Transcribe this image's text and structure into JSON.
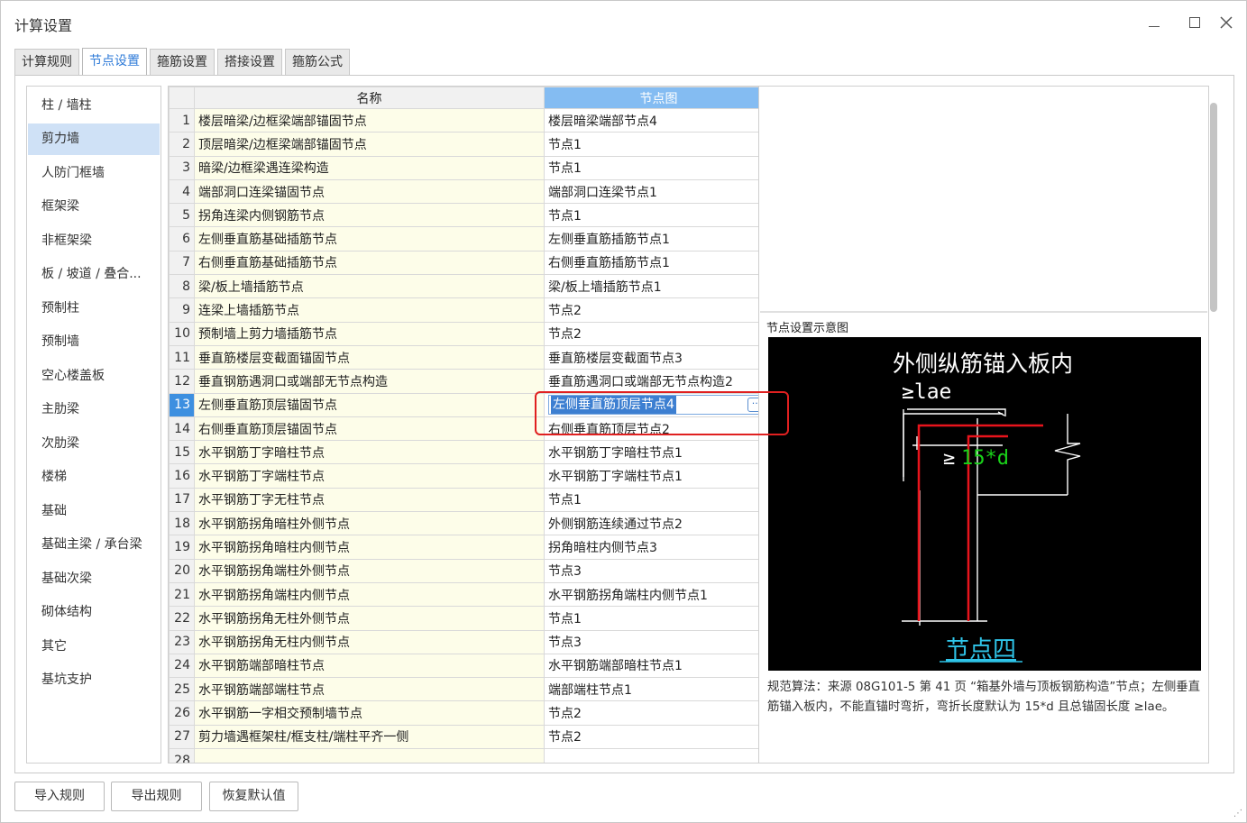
{
  "window": {
    "title": "计算设置"
  },
  "tabs": [
    "计算规则",
    "节点设置",
    "箍筋设置",
    "搭接设置",
    "箍筋公式"
  ],
  "sidebar": {
    "items": [
      "柱 / 墙柱",
      "剪力墙",
      "人防门框墙",
      "框架梁",
      "非框架梁",
      "板 / 坡道 / 叠合...",
      "预制柱",
      "预制墙",
      "空心楼盖板",
      "主肋梁",
      "次肋梁",
      "楼梯",
      "基础",
      "基础主梁 / 承台梁",
      "基础次梁",
      "砌体结构",
      "其它",
      "基坑支护"
    ]
  },
  "grid": {
    "headers": {
      "name": "名称",
      "node": "节点图"
    },
    "rows": [
      {
        "no": "1",
        "name": "楼层暗梁/边框梁端部锚固节点",
        "node": "楼层暗梁端部节点4"
      },
      {
        "no": "2",
        "name": "顶层暗梁/边框梁端部锚固节点",
        "node": "节点1"
      },
      {
        "no": "3",
        "name": "暗梁/边框梁遇连梁构造",
        "node": "节点1"
      },
      {
        "no": "4",
        "name": "端部洞口连梁锚固节点",
        "node": "端部洞口连梁节点1"
      },
      {
        "no": "5",
        "name": "拐角连梁内侧钢筋节点",
        "node": "节点1"
      },
      {
        "no": "6",
        "name": "左侧垂直筋基础插筋节点",
        "node": "左侧垂直筋插筋节点1"
      },
      {
        "no": "7",
        "name": "右侧垂直筋基础插筋节点",
        "node": "右侧垂直筋插筋节点1"
      },
      {
        "no": "8",
        "name": "梁/板上墙插筋节点",
        "node": "梁/板上墙插筋节点1"
      },
      {
        "no": "9",
        "name": "连梁上墙插筋节点",
        "node": "节点2"
      },
      {
        "no": "10",
        "name": "预制墙上剪力墙插筋节点",
        "node": "节点2"
      },
      {
        "no": "11",
        "name": "垂直筋楼层变截面锚固节点",
        "node": "垂直筋楼层变截面节点3"
      },
      {
        "no": "12",
        "name": "垂直钢筋遇洞口或端部无节点构造",
        "node": "垂直筋遇洞口或端部无节点构造2"
      },
      {
        "no": "13",
        "name": "左侧垂直筋顶层锚固节点",
        "node": "左侧垂直筋顶层节点4"
      },
      {
        "no": "14",
        "name": "右侧垂直筋顶层锚固节点",
        "node": "右侧垂直筋顶层节点2"
      },
      {
        "no": "15",
        "name": "水平钢筋丁字暗柱节点",
        "node": "水平钢筋丁字暗柱节点1"
      },
      {
        "no": "16",
        "name": "水平钢筋丁字端柱节点",
        "node": "水平钢筋丁字端柱节点1"
      },
      {
        "no": "17",
        "name": "水平钢筋丁字无柱节点",
        "node": "节点1"
      },
      {
        "no": "18",
        "name": "水平钢筋拐角暗柱外侧节点",
        "node": "外侧钢筋连续通过节点2"
      },
      {
        "no": "19",
        "name": "水平钢筋拐角暗柱内侧节点",
        "node": "拐角暗柱内侧节点3"
      },
      {
        "no": "20",
        "name": "水平钢筋拐角端柱外侧节点",
        "node": "节点3"
      },
      {
        "no": "21",
        "name": "水平钢筋拐角端柱内侧节点",
        "node": "水平钢筋拐角端柱内侧节点1"
      },
      {
        "no": "22",
        "name": "水平钢筋拐角无柱外侧节点",
        "node": "节点1"
      },
      {
        "no": "23",
        "name": "水平钢筋拐角无柱内侧节点",
        "node": "节点3"
      },
      {
        "no": "24",
        "name": "水平钢筋端部暗柱节点",
        "node": "水平钢筋端部暗柱节点1"
      },
      {
        "no": "25",
        "name": "水平钢筋端部端柱节点",
        "node": "端部端柱节点1"
      },
      {
        "no": "26",
        "name": "水平钢筋一字相交预制墙节点",
        "node": "节点2"
      },
      {
        "no": "27",
        "name": "剪力墙遇框架柱/框支柱/端柱平齐一侧",
        "node": "节点2"
      },
      {
        "no": "28",
        "name": "",
        "node": ""
      }
    ]
  },
  "diagram": {
    "label": "节点设置示意图",
    "heading": "外侧纵筋锚入板内",
    "lae_label": "≥lae",
    "d_label_prefix": "≥",
    "d_label": "15*d",
    "node_name": "节点四",
    "colors": {
      "background": "#000000",
      "rebar": "#e8141c",
      "outline": "#ffffff",
      "dim_text": "#19d219",
      "node_text": "#2fc4e8"
    }
  },
  "description": "规范算法：来源 08G101-5 第 41 页 “箱基外墙与顶板钢筋构造”节点；左侧垂直筋锚入板内，不能直锚时弯折，弯折长度默认为 15*d 且总锚固长度 ≥lae。",
  "buttons": {
    "import": "导入规则",
    "export": "导出规则",
    "restore": "恢复默认值"
  }
}
